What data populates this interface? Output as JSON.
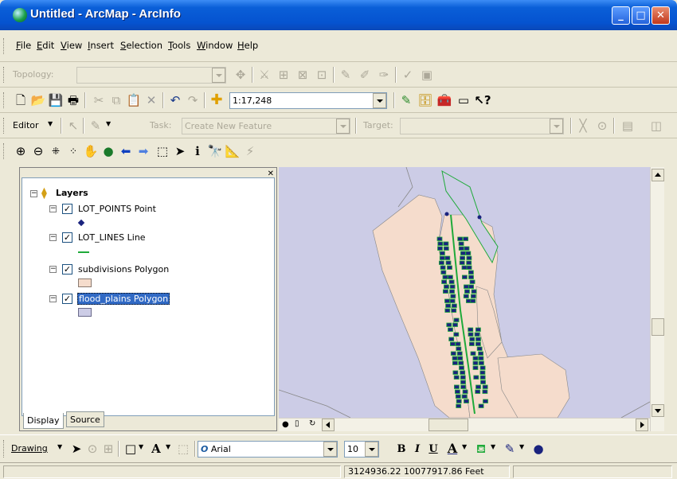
{
  "window": {
    "title": "Untitled - ArcMap - ArcInfo"
  },
  "menu": [
    "File",
    "Edit",
    "View",
    "Insert",
    "Selection",
    "Tools",
    "Window",
    "Help"
  ],
  "topology": {
    "label": "Topology:",
    "value": ""
  },
  "standard": {
    "scale": "1:17,248"
  },
  "editor": {
    "label": "Editor",
    "task_label": "Task:",
    "task_value": "Create New Feature",
    "target_label": "Target:",
    "target_value": ""
  },
  "toc": {
    "root": "Layers",
    "layers": [
      {
        "name": "LOT_POINTS Point",
        "checked": true,
        "symbol": "point",
        "color": "#1a237e"
      },
      {
        "name": "LOT_LINES Line",
        "checked": true,
        "symbol": "line",
        "color": "#1faa3a"
      },
      {
        "name": "subdivisions Polygon",
        "checked": true,
        "symbol": "polygon",
        "color": "#f5dccc"
      },
      {
        "name": "flood_plains Polygon",
        "checked": true,
        "symbol": "polygon",
        "color": "#cccce6",
        "selected": true
      }
    ],
    "tabs": [
      "Display",
      "Source"
    ]
  },
  "drawing": {
    "label": "Drawing",
    "font": "Arial",
    "size": "10"
  },
  "status": {
    "coords": "3124936.22  10077917.86 Feet"
  },
  "colors": {
    "map_bg": "#cccce6",
    "parcel": "#f5dccc",
    "lot": "#1a237e",
    "line": "#1faa3a",
    "title": "#0553d0"
  },
  "icons": {
    "standard": [
      "new",
      "open",
      "save",
      "print",
      "cut",
      "copy",
      "paste",
      "delete",
      "undo",
      "redo",
      "add-data"
    ],
    "tools": [
      "zoom-in",
      "zoom-out",
      "fixed-zoom-in",
      "fixed-zoom-out",
      "pan",
      "full-extent",
      "back",
      "forward",
      "select-features",
      "select-elements",
      "identify",
      "find",
      "measure",
      "hyperlink"
    ]
  }
}
